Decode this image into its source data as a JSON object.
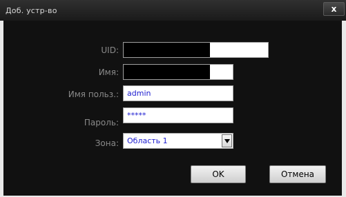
{
  "dialog": {
    "title": "Доб. устр-во",
    "close_label": "x"
  },
  "form": {
    "uid_label": "UID:",
    "name_label": "Имя:",
    "username_label": "Имя польз.:",
    "username_value": "admin",
    "password_label": "Пароль:",
    "password_value": "*****",
    "zone_label": "Зона:",
    "zone_value": "Область 1"
  },
  "buttons": {
    "ok_label": "OK",
    "cancel_label": "Отмена"
  }
}
